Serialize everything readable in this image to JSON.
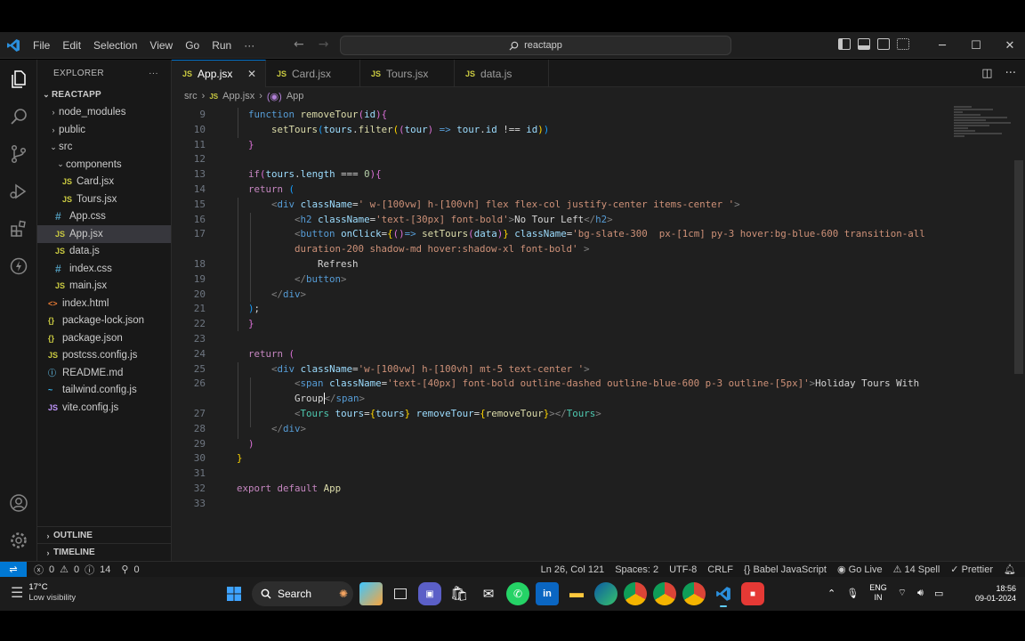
{
  "window": {
    "title": "reactapp",
    "menu": [
      "File",
      "Edit",
      "Selection",
      "View",
      "Go",
      "Run",
      "···"
    ]
  },
  "explorer": {
    "header": "EXPLORER",
    "more": "···",
    "root": "REACTAPP",
    "items": [
      {
        "label": "node_modules",
        "depth": 1,
        "kind": "folder-closed",
        "icon": ""
      },
      {
        "label": "public",
        "depth": 1,
        "kind": "folder-closed",
        "icon": ""
      },
      {
        "label": "src",
        "depth": 1,
        "kind": "folder-open",
        "icon": ""
      },
      {
        "label": "components",
        "depth": 2,
        "kind": "folder-open",
        "icon": ""
      },
      {
        "label": "Card.jsx",
        "depth": 3,
        "kind": "file",
        "icon": "JS"
      },
      {
        "label": "Tours.jsx",
        "depth": 3,
        "kind": "file",
        "icon": "JS"
      },
      {
        "label": "App.css",
        "depth": 2,
        "kind": "file",
        "icon": "#"
      },
      {
        "label": "App.jsx",
        "depth": 2,
        "kind": "file",
        "icon": "JS",
        "selected": true
      },
      {
        "label": "data.js",
        "depth": 2,
        "kind": "file",
        "icon": "JS"
      },
      {
        "label": "index.css",
        "depth": 2,
        "kind": "file",
        "icon": "#"
      },
      {
        "label": "main.jsx",
        "depth": 2,
        "kind": "file",
        "icon": "JS"
      },
      {
        "label": "index.html",
        "depth": 1,
        "kind": "file",
        "icon": "<>"
      },
      {
        "label": "package-lock.json",
        "depth": 1,
        "kind": "file",
        "icon": "{}"
      },
      {
        "label": "package.json",
        "depth": 1,
        "kind": "file",
        "icon": "{}"
      },
      {
        "label": "postcss.config.js",
        "depth": 1,
        "kind": "file",
        "icon": "JS"
      },
      {
        "label": "README.md",
        "depth": 1,
        "kind": "file",
        "icon": "ⓘ"
      },
      {
        "label": "tailwind.config.js",
        "depth": 1,
        "kind": "file",
        "icon": "~"
      },
      {
        "label": "vite.config.js",
        "depth": 1,
        "kind": "file",
        "icon": "JS"
      }
    ],
    "outline": "OUTLINE",
    "timeline": "TIMELINE"
  },
  "tabs": [
    {
      "label": "App.jsx",
      "active": true
    },
    {
      "label": "Card.jsx",
      "active": false
    },
    {
      "label": "Tours.jsx",
      "active": false
    },
    {
      "label": "data.js",
      "active": false
    }
  ],
  "breadcrumb": {
    "folder": "src",
    "file": "App.jsx",
    "symbol": "App"
  },
  "code": {
    "line_numbers": [
      "9",
      "10",
      "11",
      "12",
      "13",
      "14",
      "15",
      "16",
      "17",
      "",
      "18",
      "19",
      "20",
      "21",
      "22",
      "23",
      "24",
      "25",
      "26",
      "",
      "27",
      "28",
      "29",
      "30",
      "31",
      "32",
      "33"
    ]
  },
  "status": {
    "errors": "0",
    "warnings": "0",
    "info": "14",
    "ports": "0",
    "position": "Ln 26, Col 121",
    "spaces": "Spaces: 2",
    "encoding": "UTF-8",
    "eol": "CRLF",
    "language": "Babel JavaScript",
    "golive": "Go Live",
    "spell": "14 Spell",
    "prettier": "Prettier"
  },
  "taskbar": {
    "weather_temp": "17°C",
    "weather_desc": "Low visibility",
    "search": "Search",
    "lang": "ENG",
    "region": "IN",
    "time": "18:56",
    "date": "09-01-2024"
  },
  "colors": {
    "accent": "#0078d4",
    "editor_bg": "#1f1f1f",
    "sidebar_bg": "#181818"
  }
}
